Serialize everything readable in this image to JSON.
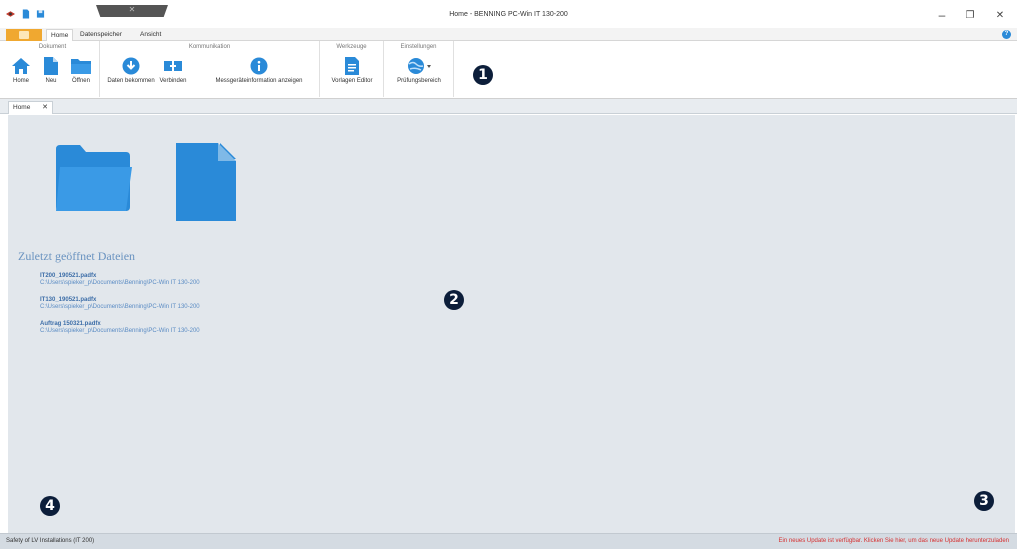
{
  "window": {
    "title": "Home - BENNING PC-Win IT 130-200",
    "minimize": "–",
    "restore": "❐",
    "close": "✕"
  },
  "ribbon_tabs": {
    "home": "Home",
    "datenspeicher": "Datenspeicher",
    "ansicht": "Ansicht"
  },
  "ribbon": {
    "groups": {
      "dokument": "Dokument",
      "kommunikation": "Kommunikation",
      "werkzeuge": "Werkzeuge",
      "einstellungen": "Einstellungen"
    },
    "buttons": {
      "home": "Home",
      "neu": "Neu",
      "oeffnen": "Öffnen",
      "daten_bekommen": "Daten bekommen",
      "verbinden": "Verbinden",
      "messgeraeteinformation": "Messgeräteinformation anzeigen",
      "vorlagen_editor": "Vorlagen Editor",
      "pruefungsbereich": "Prüfungsbereich"
    }
  },
  "callouts": {
    "c1": "1",
    "c2": "2",
    "c3": "3",
    "c4": "4"
  },
  "doc_tabs": {
    "home": "Home",
    "close": "✕"
  },
  "recent": {
    "title": "Zuletzt geöffnet Dateien",
    "files": [
      {
        "name": "IT200_190521.padfx",
        "path": "C:\\Users\\spieker_p\\Documents\\Benning\\PC-Win IT 130-200"
      },
      {
        "name": "IT130_190521.padfx",
        "path": "C:\\Users\\spieker_p\\Documents\\Benning\\PC-Win IT 130-200"
      },
      {
        "name": "Auftrag 150321.padfx",
        "path": "C:\\Users\\spieker_p\\Documents\\Benning\\PC-Win IT 130-200"
      }
    ]
  },
  "status": {
    "left": "Safety of LV Installations (IT 200)",
    "right": "Ein neues Update ist verfügbar. Klicken Sie hier, um das neue Update herunterzuladen"
  },
  "colors": {
    "accent_blue": "#2a8ad8",
    "file_tab": "#f0a830",
    "update_red": "#d63030"
  }
}
